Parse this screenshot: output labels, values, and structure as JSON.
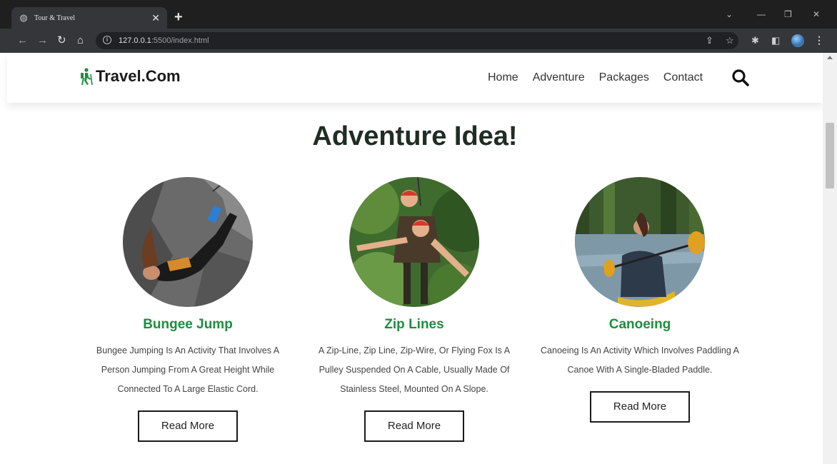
{
  "browser": {
    "tab_title": "Tour & Travel",
    "url_host": "127.0.0.1",
    "url_path": ":5500/index.html"
  },
  "site": {
    "brand": "Travel.Com",
    "brand_color": "#1d8e3e",
    "nav": [
      "Home",
      "Adventure",
      "Packages",
      "Contact"
    ]
  },
  "section": {
    "title": "Adventure Idea!"
  },
  "cards": [
    {
      "name": "Bungee Jump",
      "description": "Bungee Jumping Is An Activity That Involves A Person Jumping From A Great Height While Connected To A Large Elastic Cord.",
      "button": "Read More"
    },
    {
      "name": "Zip Lines",
      "description": "A Zip-Line, Zip Line, Zip-Wire, Or Flying Fox Is A Pulley Suspended On A Cable, Usually Made Of Stainless Steel, Mounted On A Slope.",
      "button": "Read More"
    },
    {
      "name": "Canoeing",
      "description": "Canoeing Is An Activity Which Involves Paddling A Canoe With A Single-Bladed Paddle.",
      "button": "Read More"
    }
  ]
}
